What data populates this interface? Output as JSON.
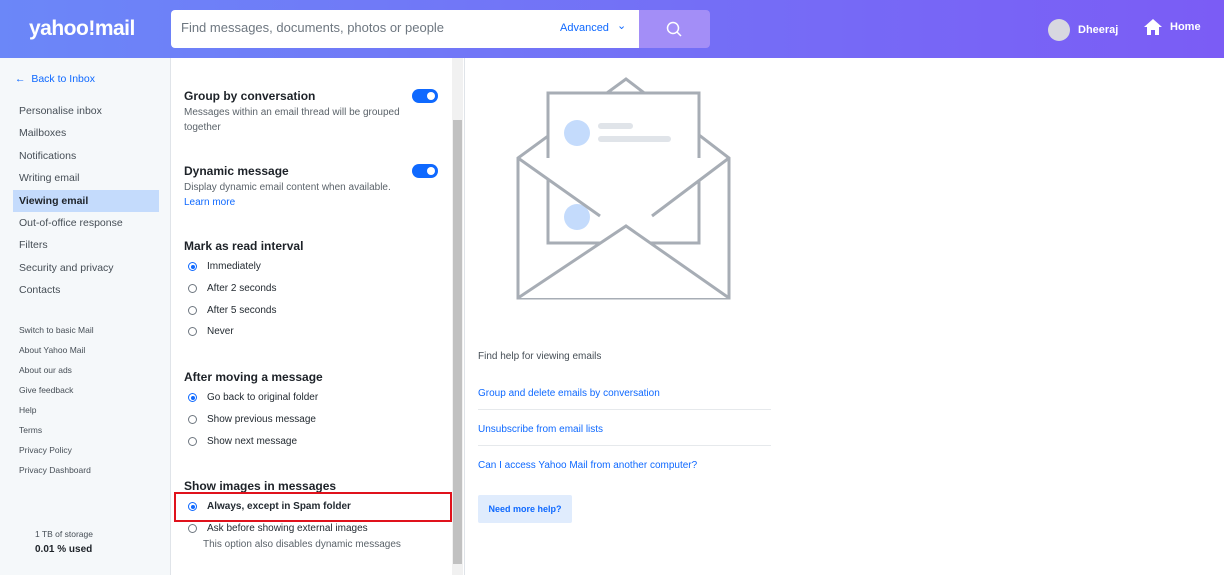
{
  "header": {
    "logo": "yahoo!mail",
    "search_placeholder": "Find messages, documents, photos or people",
    "advanced": "Advanced",
    "user": "Dheeraj",
    "home": "Home"
  },
  "sidebar": {
    "back": "Back to Inbox",
    "items": [
      "Personalise inbox",
      "Mailboxes",
      "Notifications",
      "Writing email",
      "Viewing email",
      "Out-of-office response",
      "Filters",
      "Security and privacy",
      "Contacts"
    ],
    "active": "Viewing email",
    "links": [
      "Switch to basic Mail",
      "About Yahoo Mail",
      "About our ads",
      "Give feedback",
      "Help",
      "Terms",
      "Privacy Policy",
      "Privacy Dashboard"
    ],
    "storage": "1 TB of storage",
    "used": "0.01 % used"
  },
  "settings": {
    "group": {
      "title": "Group by conversation",
      "desc": "Messages within an email thread will be grouped together",
      "enabled": true
    },
    "dynamic": {
      "title": "Dynamic message",
      "desc": "Display dynamic email content when available.",
      "link": "Learn more",
      "enabled": true
    },
    "read": {
      "title": "Mark as read interval",
      "options": [
        "Immediately",
        "After 2 seconds",
        "After 5 seconds",
        "Never"
      ],
      "selected": "Immediately"
    },
    "moving": {
      "title": "After moving a message",
      "options": [
        "Go back to original folder",
        "Show previous message",
        "Show next message"
      ],
      "selected": "Go back to original folder"
    },
    "images": {
      "title": "Show images in messages",
      "options": [
        "Always, except in Spam folder",
        "Ask before showing external images"
      ],
      "note": "This option also disables dynamic messages",
      "selected": "Always, except in Spam folder"
    }
  },
  "help": {
    "title": "Find help for viewing emails",
    "links": [
      "Group and delete emails by conversation",
      "Unsubscribe from email lists",
      "Can I access Yahoo Mail from another computer?"
    ],
    "button": "Need more help?"
  }
}
